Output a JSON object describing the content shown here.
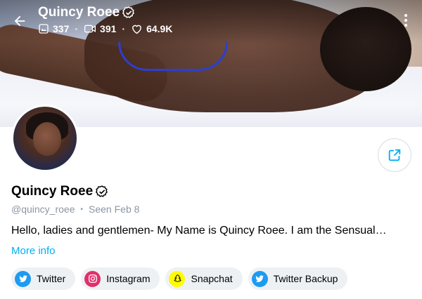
{
  "header": {
    "title": "Quincy Roee",
    "stats": [
      {
        "icon": "photo-icon",
        "value": "337"
      },
      {
        "icon": "video-icon",
        "value": "391"
      },
      {
        "icon": "heart-icon",
        "value": "64.9K"
      }
    ]
  },
  "profile": {
    "name": "Quincy Roee",
    "handle": "@quincy_roee",
    "seen": "Seen Feb 8",
    "bio": "Hello, ladies and gentlemen- My Name is Quincy Roee. I am the Sensual…",
    "more_info_label": "More info"
  },
  "socials": [
    {
      "label": "Twitter",
      "icon": "twitter-icon",
      "color": "#1d9bf0"
    },
    {
      "label": "Instagram",
      "icon": "instagram-icon",
      "color": "#e1306c"
    },
    {
      "label": "Snapchat",
      "icon": "snapchat-icon",
      "color": "#fffc00"
    },
    {
      "label": "Twitter Backup",
      "icon": "twitter-icon",
      "color": "#1d9bf0"
    }
  ],
  "colors": {
    "accent": "#00aff0",
    "muted_text": "#8a96a3",
    "chip_bg": "#eef1f4"
  }
}
